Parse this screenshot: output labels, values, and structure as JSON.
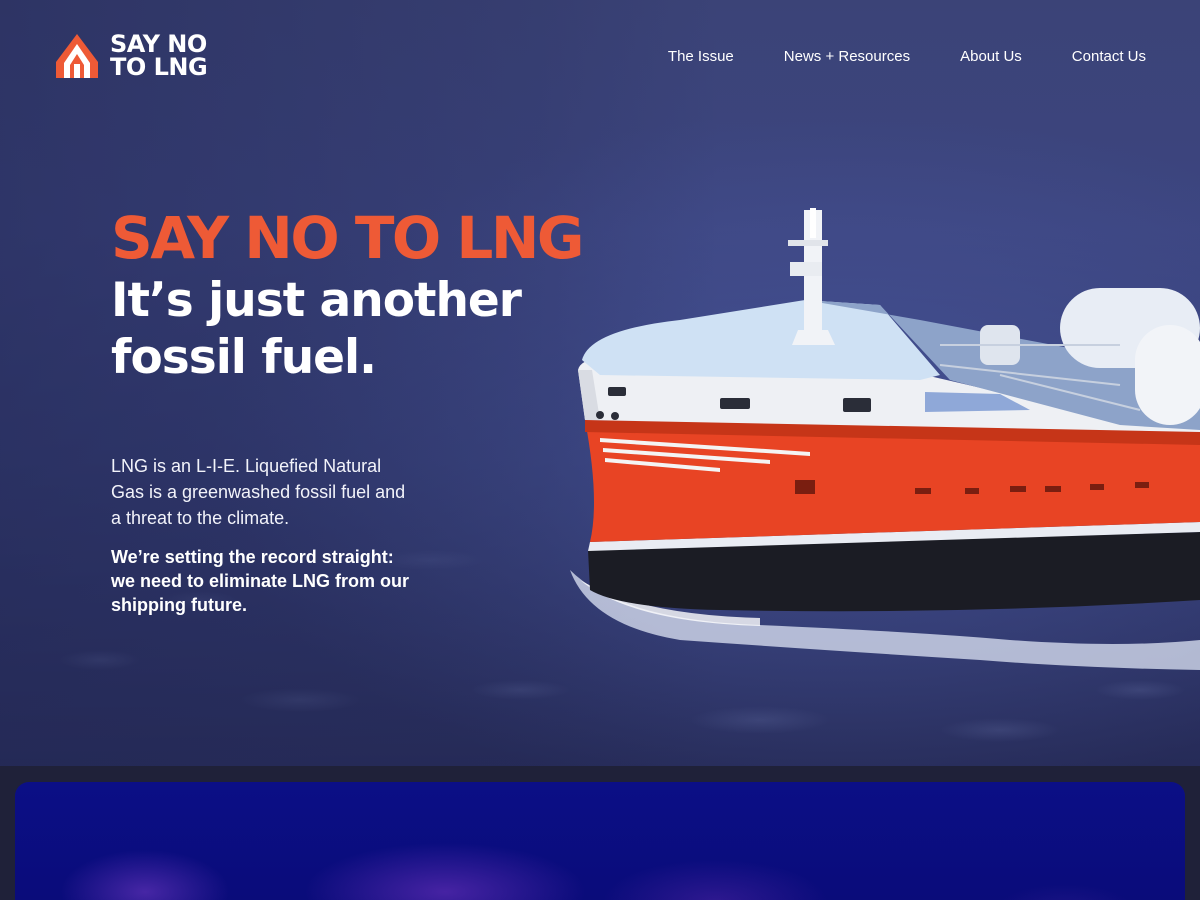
{
  "brand": {
    "logo_line1": "SAY NO",
    "logo_line2": "TO LNG",
    "accent_color": "#ee5a36"
  },
  "nav": {
    "items": [
      {
        "label": "The Issue"
      },
      {
        "label": "News + Resources"
      },
      {
        "label": "About Us"
      },
      {
        "label": "Contact Us"
      }
    ]
  },
  "hero": {
    "headline": "SAY NO TO LNG",
    "subheadline": "It’s just another fossil fuel.",
    "intro": "LNG is an L-I-E. Liquefied Natural Gas is a greenwashed fossil fuel and a threat to the climate.",
    "cta_text": "We’re setting the record straight: we need to eliminate LNG from our shipping future.",
    "image": "lng-tanker-ship-photo"
  },
  "colors": {
    "hero_background": "#3c4580",
    "ship_hull": "#e84424",
    "lower_card": "#0b0f86"
  }
}
